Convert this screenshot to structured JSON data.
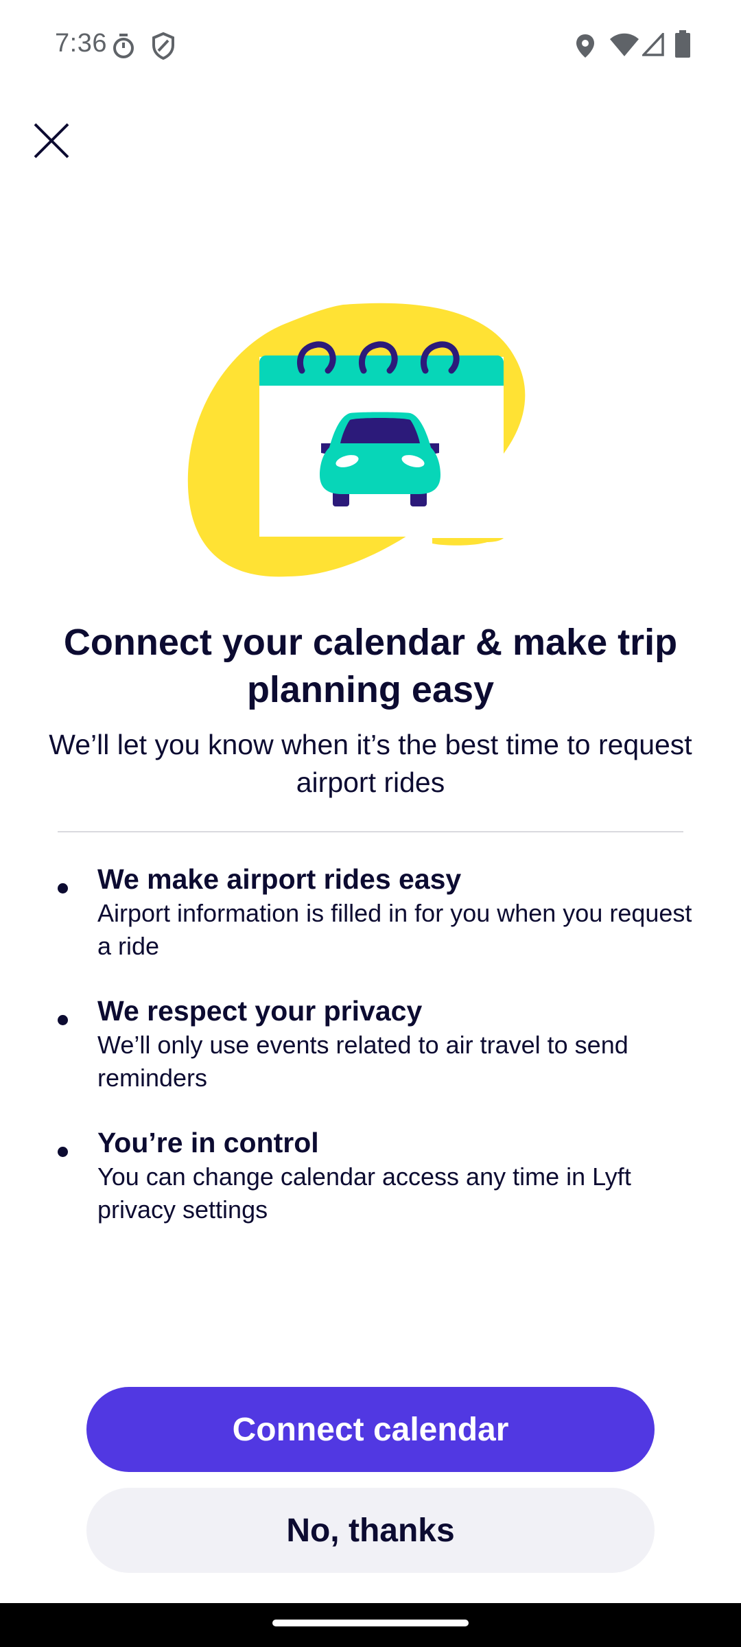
{
  "status_bar": {
    "time": "7:36",
    "left_icons": [
      "timer-icon",
      "shield-icon"
    ],
    "right_icons": [
      "location-icon",
      "wifi-icon",
      "signal-icon",
      "battery-icon"
    ]
  },
  "close_icon": "close-icon",
  "illustration": {
    "subject": "calendar-with-car",
    "colors": {
      "blob": "#ffe234",
      "calendar_header": "#07d6b8",
      "rings": "#2c1a7a",
      "car": "#07d6b8",
      "car_dark": "#2c1a7a"
    }
  },
  "headline": "Connect your calendar & make trip planning easy",
  "subtitle": "We’ll let you know when it’s the best time to request airport rides",
  "benefits": [
    {
      "title": "We make airport rides easy",
      "description": "Airport information is filled in for you when you request a ride"
    },
    {
      "title": "We respect your privacy",
      "description": "We’ll only use events related to air travel to send reminders"
    },
    {
      "title": "You’re in control",
      "description": "You can change calendar access any time in Lyft privacy settings"
    }
  ],
  "buttons": {
    "primary_label": "Connect calendar",
    "secondary_label": "No, thanks"
  },
  "colors": {
    "accent": "#5138e2",
    "text": "#0c0b31",
    "secondary_button_bg": "#f1f1f6"
  }
}
